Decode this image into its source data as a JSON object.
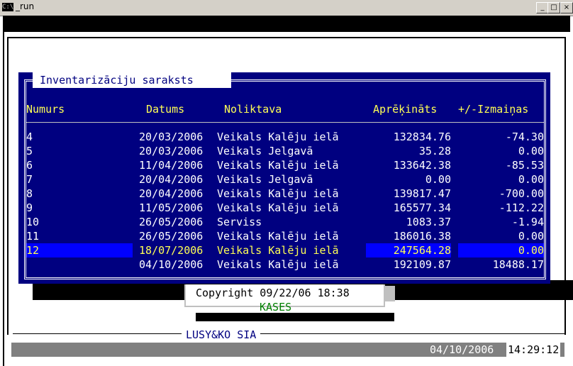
{
  "window": {
    "icon_text": "C:\\",
    "title": "_run",
    "buttons": [
      "_",
      "□",
      "×"
    ]
  },
  "dialog": {
    "title": "Inventarizāciju saraksts",
    "columns": [
      "Numurs",
      "Datums",
      "Noliktava",
      "Aprēķināts",
      "+/-Izmaiņas"
    ],
    "rows": [
      {
        "num": "4",
        "date": "20/03/2006",
        "store": "Veikals Kalēju ielā",
        "calc": "132834.76",
        "change": "-74.30"
      },
      {
        "num": "5",
        "date": "20/03/2006",
        "store": "Veikals Jelgavā",
        "calc": "35.28",
        "change": "0.00"
      },
      {
        "num": "6",
        "date": "11/04/2006",
        "store": "Veikals Kalēju ielā",
        "calc": "133642.38",
        "change": "-85.53"
      },
      {
        "num": "7",
        "date": "20/04/2006",
        "store": "Veikals Jelgavā",
        "calc": "0.00",
        "change": "0.00"
      },
      {
        "num": "8",
        "date": "20/04/2006",
        "store": "Veikals Kalēju ielā",
        "calc": "139817.47",
        "change": "-700.00"
      },
      {
        "num": "9",
        "date": "11/05/2006",
        "store": "Veikals Kalēju ielā",
        "calc": "165577.34",
        "change": "-112.22"
      },
      {
        "num": "10",
        "date": "26/05/2006",
        "store": "Serviss",
        "calc": "1083.37",
        "change": "-1.94"
      },
      {
        "num": "11",
        "date": "26/05/2006",
        "store": "Veikals Kalēju ielā",
        "calc": "186016.38",
        "change": "0.00"
      },
      {
        "num": "12",
        "date": "18/07/2006",
        "store": "Veikals Kalēju ielā",
        "calc": "247564.28",
        "change": "0.00",
        "selected": true
      },
      {
        "num": "",
        "date": "04/10/2006",
        "store": "Veikals Kalēju ielā",
        "calc": "192109.87",
        "change": "18488.17"
      }
    ]
  },
  "copyright": "Copyright 09/22/06 18:38",
  "menu_title": "KASES",
  "company": "LUSY&KO SIA",
  "status": {
    "date": "04/10/2006",
    "time": "14:29:12"
  }
}
